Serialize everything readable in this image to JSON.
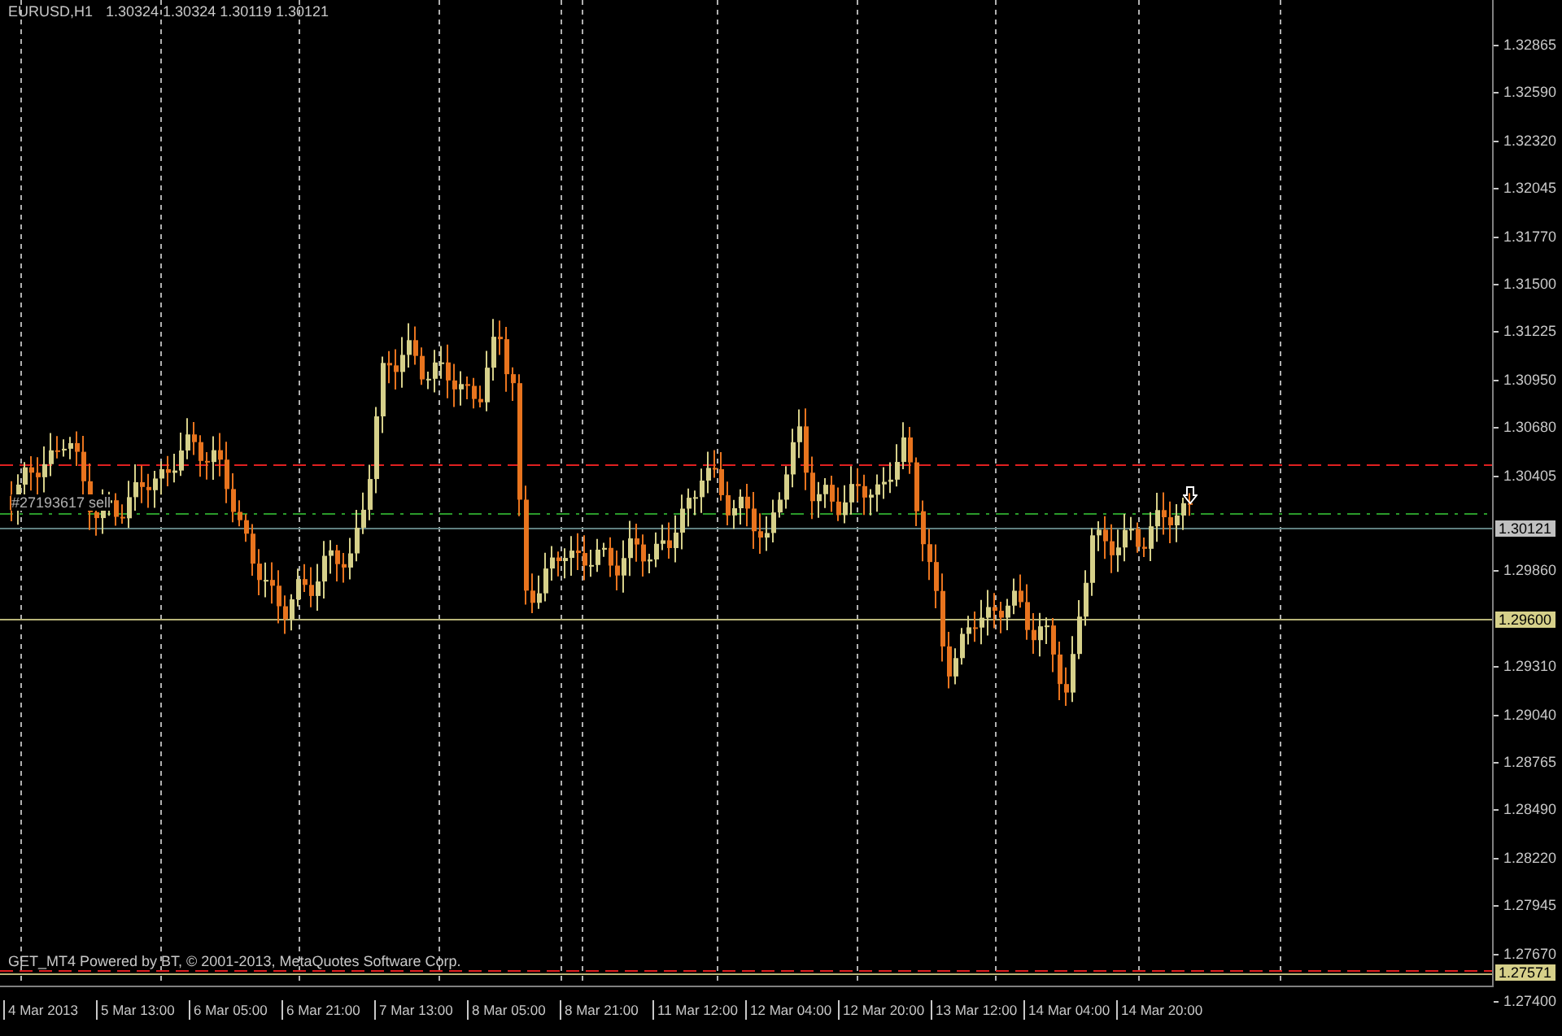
{
  "chart": {
    "symbol": "EURUSD,H1",
    "quote": "1.30324 1.30324 1.30119 1.30121",
    "order_label": "#27193617 sell",
    "footer": "GET_MT4 Powered by BT, © 2001-2013, MetaQuotes Software Corp."
  },
  "price_axis": {
    "ticks": [
      "1.32865",
      "1.32590",
      "1.32320",
      "1.32045",
      "1.31770",
      "1.31500",
      "1.31225",
      "1.30950",
      "1.30680",
      "1.30405",
      "1.29860",
      "1.29310",
      "1.29040",
      "1.28765",
      "1.28490",
      "1.28220",
      "1.27945",
      "1.27670",
      "1.27400"
    ],
    "markers": [
      {
        "label": "1.30121",
        "color": "#c0c0c0"
      },
      {
        "label": "1.29600",
        "color": "#d6d08a"
      },
      {
        "label": "1.27571",
        "color": "#d6d08a"
      }
    ]
  },
  "time_axis": {
    "labels": [
      "4 Mar 2013",
      "5 Mar 13:00",
      "6 Mar 05:00",
      "6 Mar 21:00",
      "7 Mar 13:00",
      "8 Mar 05:00",
      "8 Mar 21:00",
      "11 Mar 12:00",
      "12 Mar 04:00",
      "12 Mar 20:00",
      "13 Mar 12:00",
      "14 Mar 04:00",
      "14 Mar 20:00"
    ]
  }
}
